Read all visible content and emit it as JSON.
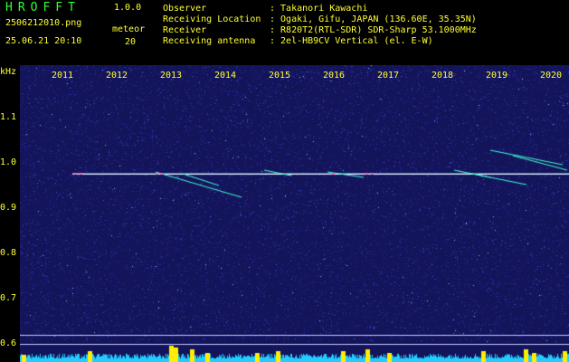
{
  "header": {
    "app_title": "HROFFT",
    "app_version": "1.0.0",
    "file_name": "2506212010.png",
    "datetime": "25.06.21 20:10",
    "meteor_label": "meteor",
    "meteor_count": "20",
    "info": [
      {
        "key": "Observer",
        "value": ": Takanori Kawachi"
      },
      {
        "key": "Receiving Location",
        "value": ": Ogaki, Gifu, JAPAN (136.60E, 35.35N)"
      },
      {
        "key": "Receiver",
        "value": ": R820T2(RTL-SDR) SDR-Sharp 53.1000MHz"
      },
      {
        "key": "Receiving antenna",
        "value": ": 2el-HB9CV Vertical (el. E-W)"
      }
    ]
  },
  "axis": {
    "unit": "kHz",
    "y_ticks": [
      "1.1",
      "1.0",
      "0.9",
      "0.8",
      "0.7",
      "0.6"
    ],
    "x_ticks": [
      "2011",
      "2012",
      "2013",
      "2014",
      "2015",
      "2016",
      "2017",
      "2018",
      "2019",
      "2020"
    ]
  },
  "colors": {
    "background_noise": "#14145a",
    "carrier": "#e8f0ff",
    "meteor_trail": "#40ffd0",
    "text_yellow": "#ffff33",
    "title_green": "#33ff33",
    "level_bars_cyan": "#22ccff",
    "level_peaks_yellow": "#ffee00"
  }
}
